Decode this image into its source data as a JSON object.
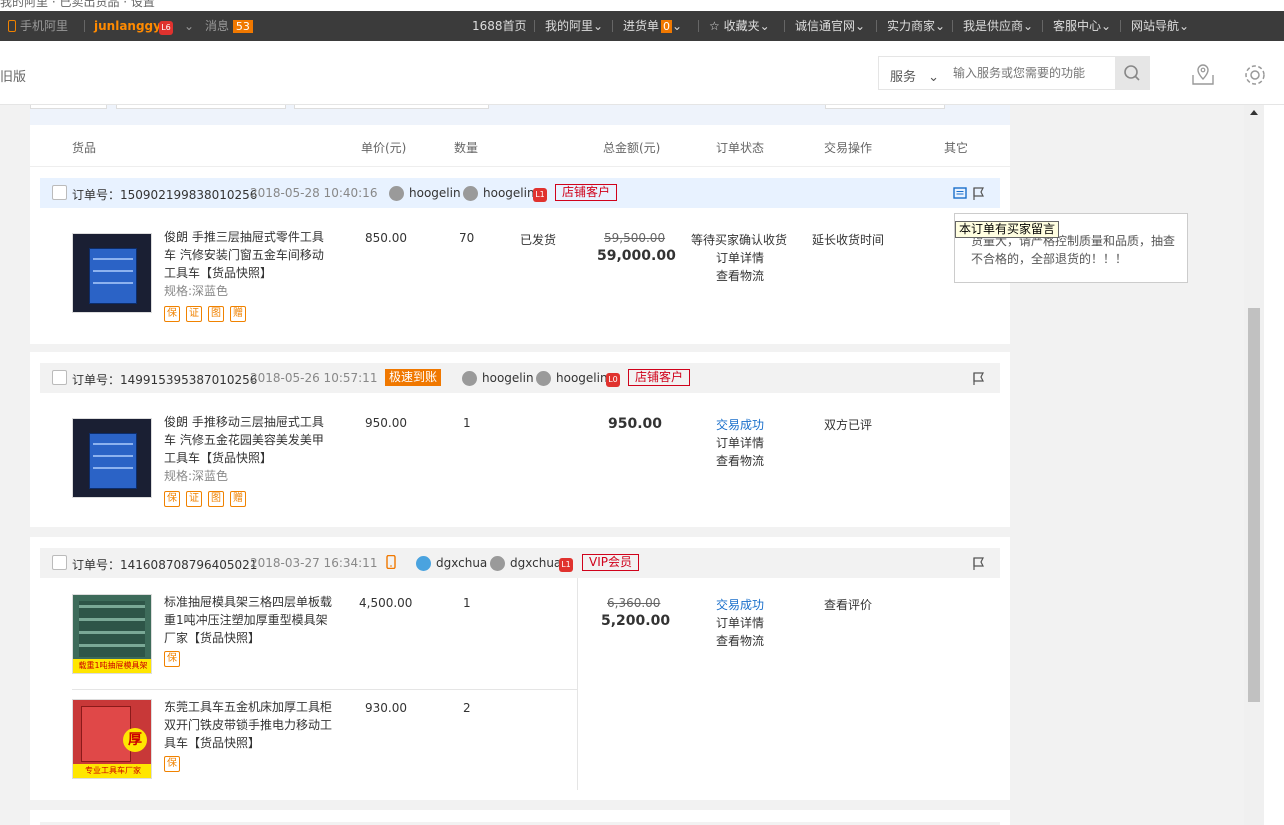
{
  "topstrip": {
    "text": "我的阿里 · 已卖出货品 · 设置"
  },
  "topbar": {
    "mobile": "手机阿里",
    "username": "junlanggy",
    "user_level": "L6",
    "messages_label": "消息",
    "messages_count": "53",
    "nav": [
      "1688首页",
      "我的阿里",
      "进货单",
      "收藏夹",
      "诚信通官网",
      "实力商家",
      "我是供应商",
      "客服中心",
      "网站导航"
    ],
    "cart_count": "0"
  },
  "header": {
    "old_version": "旧版",
    "service_label": "服务",
    "search_placeholder": "输入服务或您需要的功能"
  },
  "columns": [
    "货品",
    "单价(元)",
    "数量",
    "总金额(元)",
    "订单状态",
    "交易操作",
    "其它"
  ],
  "orders": [
    {
      "order_label": "订单号：",
      "order_no": "150902199838010256",
      "time": "2018-05-28 10:40:16",
      "buyer": "hoogelin",
      "seller": "hoogelin",
      "seller_level": "L1",
      "customer_tag": "店铺客户",
      "items": [
        {
          "name": "俊朗 手推三层抽屉式零件工具车 汽修安装门窗五金车间移动工具车",
          "snapshot": "【货品快照】",
          "spec": "规格:深蓝色",
          "price": "850.00",
          "qty": "70",
          "ship": "已发货",
          "badges": [
            "保",
            "证",
            "图",
            "赠"
          ]
        }
      ],
      "original_total": "59,500.00",
      "total": "59,000.00",
      "status": [
        "等待买家确认收货",
        "订单详情",
        "查看物流"
      ],
      "action": "延长收货时间"
    },
    {
      "order_label": "订单号：",
      "order_no": "149915395387010256",
      "time": "2018-05-26 10:57:11",
      "fast_tag": "极速到账",
      "buyer": "hoogelin",
      "seller": "hoogelin",
      "seller_level": "L0",
      "customer_tag": "店铺客户",
      "items": [
        {
          "name": "俊朗 手推移动三层抽屉式工具车 汽修五金花园美容美发美甲工具车",
          "snapshot": "【货品快照】",
          "spec": "规格:深蓝色",
          "price": "950.00",
          "qty": "1",
          "badges": [
            "保",
            "证",
            "图",
            "赠"
          ]
        }
      ],
      "total": "950.00",
      "status": [
        "交易成功",
        "订单详情",
        "查看物流"
      ],
      "action": "双方已评"
    },
    {
      "order_label": "订单号：",
      "order_no": "141608708796405021",
      "time": "2018-03-27 16:34:11",
      "buyer": "dgxchua",
      "seller": "dgxchua",
      "seller_level": "L1",
      "customer_tag": "VIP会员",
      "items": [
        {
          "name": "标准抽屉模具架三格四层单板载重1吨冲压注塑加厚重型模具架厂家",
          "snapshot": "【货品快照】",
          "price": "4,500.00",
          "qty": "1",
          "badges": [
            "保"
          ],
          "thumb_text": "载重1吨抽屉模具架"
        },
        {
          "name": "东莞工具车五金机床加厚工具柜双开门铁皮带锁手推电力移动工具车",
          "snapshot": "【货品快照】",
          "price": "930.00",
          "qty": "2",
          "badges": [
            "保"
          ],
          "thumb_text": "专业工具车厂家",
          "thumb_big": "厚"
        }
      ],
      "original_total": "6,360.00",
      "total": "5,200.00",
      "status": [
        "交易成功",
        "订单详情",
        "查看物流"
      ],
      "action": "查看评价"
    }
  ],
  "tooltip": {
    "title": "本订单有买家留言",
    "body": "货量大，请严格控制质量和品质，抽查不合格的，全部退货的！！！"
  },
  "colors": {
    "accent": "#ff6a00",
    "link": "#1a6fcb",
    "red": "#d0021b",
    "topbar": "#3b3b3b"
  }
}
